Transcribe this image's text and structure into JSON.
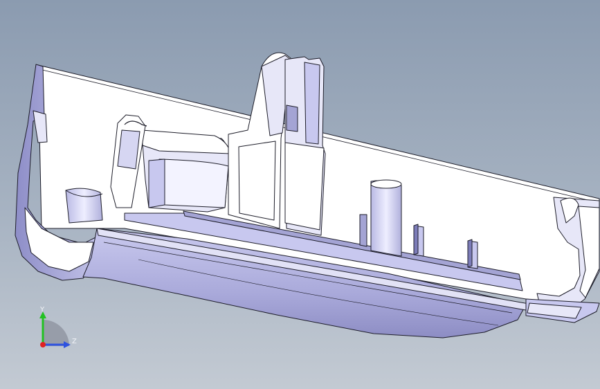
{
  "viewport": {
    "background_top": "#8b9bb0",
    "background_bottom": "#c3cad3"
  },
  "part_colors": {
    "edge": "#1c1c28",
    "white_face": "#ffffff",
    "lavender_light": "#e7e7f8",
    "lavender_mid": "#c8c8ef",
    "lavender_dark": "#a4a4d4"
  },
  "triad": {
    "y_label": "Y",
    "z_label": "Z",
    "y_color": "#22c122",
    "z_color": "#2e52e0",
    "x_color": "#e02222"
  }
}
